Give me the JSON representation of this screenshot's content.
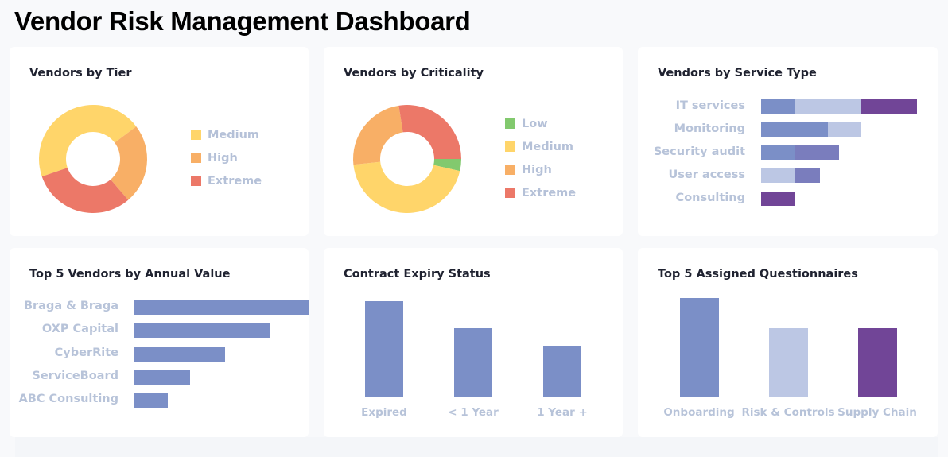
{
  "page": {
    "title": "Vendor Risk Management Dashboard"
  },
  "colors": {
    "low": "#82c96e",
    "medium": "#ffd56a",
    "high": "#f8af66",
    "extreme": "#ec7868",
    "blue": "#7b8fc7",
    "light_blue": "#bcc7e4",
    "indigo": "#7a7dbd",
    "purple": "#714597"
  },
  "chart_data": [
    {
      "id": "tier",
      "type": "pie",
      "title": "Vendors by Tier",
      "donut": true,
      "legend_position": "right",
      "slices": [
        {
          "label": "Medium",
          "value": 45,
          "color": "#ffd56a"
        },
        {
          "label": "High",
          "value": 24,
          "color": "#f8af66"
        },
        {
          "label": "Extreme",
          "value": 31,
          "color": "#ec7868"
        }
      ]
    },
    {
      "id": "criticality",
      "type": "pie",
      "title": "Vendors by Criticality",
      "donut": true,
      "legend_position": "right",
      "slices": [
        {
          "label": "Low",
          "value": 3.6,
          "color": "#82c96e"
        },
        {
          "label": "Medium",
          "value": 44.7,
          "color": "#ffd56a"
        },
        {
          "label": "High",
          "value": 24.2,
          "color": "#f8af66"
        },
        {
          "label": "Extreme",
          "value": 27.5,
          "color": "#ec7868"
        }
      ]
    },
    {
      "id": "service_type",
      "type": "bar",
      "orientation": "horizontal",
      "stacked": true,
      "title": "Vendors by Service Type",
      "categories": [
        "IT services",
        "Monitoring",
        "Security audit",
        "User access",
        "Consulting"
      ],
      "segments": [
        [
          {
            "value": 3,
            "color": "#7b8fc7"
          },
          {
            "value": 6,
            "color": "#bcc7e4"
          },
          {
            "value": 5,
            "color": "#714597"
          }
        ],
        [
          {
            "value": 6,
            "color": "#7b8fc7"
          },
          {
            "value": 3,
            "color": "#bcc7e4"
          }
        ],
        [
          {
            "value": 3,
            "color": "#7b8fc7"
          },
          {
            "value": 4,
            "color": "#7a7dbd"
          }
        ],
        [
          {
            "value": 3,
            "color": "#bcc7e4"
          },
          {
            "value": 2.3,
            "color": "#7a7dbd"
          }
        ],
        [
          {
            "value": 3,
            "color": "#714597"
          }
        ]
      ],
      "xmax": 14
    },
    {
      "id": "annual_value",
      "type": "bar",
      "orientation": "horizontal",
      "title": "Top 5 Vendors by Annual Value",
      "categories": [
        "Braga & Braga",
        "OXP Capital",
        "CyberRite",
        "ServiceBoard",
        "ABC Consulting"
      ],
      "values": [
        100,
        78,
        52,
        32,
        19
      ],
      "color": "#7b8fc7",
      "xmax": 100
    },
    {
      "id": "contract_expiry",
      "type": "bar",
      "orientation": "vertical",
      "title": "Contract Expiry Status",
      "categories": [
        "Expired",
        "< 1 Year",
        "1 Year +"
      ],
      "values": [
        100,
        72,
        54
      ],
      "color": "#7b8fc7",
      "ymax": 100
    },
    {
      "id": "questionnaires",
      "type": "bar",
      "orientation": "vertical",
      "title": "Top 5 Assigned Questionnaires",
      "categories": [
        "Onboarding",
        "Risk & Controls",
        "Supply Chain"
      ],
      "values": [
        100,
        70,
        70
      ],
      "colors": [
        "#7b8fc7",
        "#bcc7e4",
        "#714597"
      ],
      "ymax": 100
    }
  ]
}
